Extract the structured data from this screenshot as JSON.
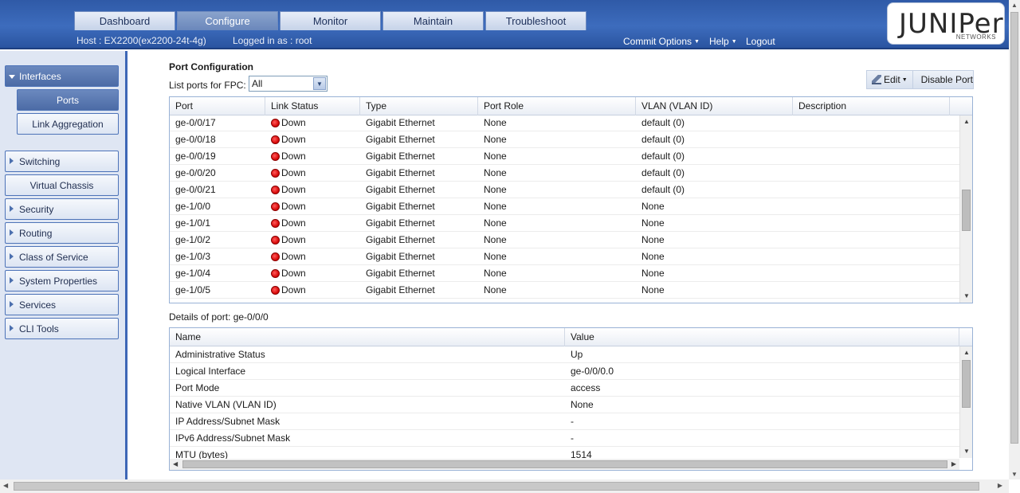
{
  "header": {
    "tabs": [
      {
        "label": "Dashboard",
        "active": false
      },
      {
        "label": "Configure",
        "active": true
      },
      {
        "label": "Monitor",
        "active": false
      },
      {
        "label": "Maintain",
        "active": false
      },
      {
        "label": "Troubleshoot",
        "active": false
      }
    ],
    "host": "Host : EX2200(ex2200-24t-4g)",
    "logged_in": "Logged in as : root",
    "commit_options": "Commit Options",
    "help": "Help",
    "logout": "Logout",
    "logo": "JUNIPer",
    "logo_sub": "NETWORKS"
  },
  "sidebar": {
    "interfaces": "Interfaces",
    "ports": "Ports",
    "link_aggregation": "Link Aggregation",
    "switching": "Switching",
    "virtual_chassis": "Virtual Chassis",
    "security": "Security",
    "routing": "Routing",
    "class_of_service": "Class of Service",
    "system_properties": "System Properties",
    "services": "Services",
    "cli_tools": "CLI Tools"
  },
  "main": {
    "title": "Port Configuration",
    "fpc_label": "List ports for FPC:",
    "fpc_value": "All",
    "edit": "Edit",
    "disable_port": "Disable Port",
    "ports_columns": [
      "Port",
      "Link Status",
      "Type",
      "Port Role",
      "VLAN (VLAN ID)",
      "Description"
    ],
    "ports_rows": [
      [
        "ge-0/0/17",
        "Down",
        "Gigabit Ethernet",
        "None",
        "default (0)",
        ""
      ],
      [
        "ge-0/0/18",
        "Down",
        "Gigabit Ethernet",
        "None",
        "default (0)",
        ""
      ],
      [
        "ge-0/0/19",
        "Down",
        "Gigabit Ethernet",
        "None",
        "default (0)",
        ""
      ],
      [
        "ge-0/0/20",
        "Down",
        "Gigabit Ethernet",
        "None",
        "default (0)",
        ""
      ],
      [
        "ge-0/0/21",
        "Down",
        "Gigabit Ethernet",
        "None",
        "default (0)",
        ""
      ],
      [
        "ge-1/0/0",
        "Down",
        "Gigabit Ethernet",
        "None",
        "None",
        ""
      ],
      [
        "ge-1/0/1",
        "Down",
        "Gigabit Ethernet",
        "None",
        "None",
        ""
      ],
      [
        "ge-1/0/2",
        "Down",
        "Gigabit Ethernet",
        "None",
        "None",
        ""
      ],
      [
        "ge-1/0/3",
        "Down",
        "Gigabit Ethernet",
        "None",
        "None",
        ""
      ],
      [
        "ge-1/0/4",
        "Down",
        "Gigabit Ethernet",
        "None",
        "None",
        ""
      ],
      [
        "ge-1/0/5",
        "Down",
        "Gigabit Ethernet",
        "None",
        "None",
        ""
      ]
    ],
    "details_label": "Details of port: ge-0/0/0",
    "details_columns": [
      "Name",
      "Value"
    ],
    "details_rows": [
      [
        "Administrative Status",
        "Up"
      ],
      [
        "Logical Interface",
        "ge-0/0/0.0"
      ],
      [
        "Port Mode",
        "access"
      ],
      [
        "Native VLAN (VLAN ID)",
        "None"
      ],
      [
        "IP Address/Subnet Mask",
        "-"
      ],
      [
        "IPv6 Address/Subnet Mask",
        "-"
      ],
      [
        "MTU (bytes)",
        "1514"
      ]
    ]
  },
  "colors": {
    "header_blue": "#3d6cbd",
    "link_down_red": "#d40000",
    "sidebar_border": "#3d67b6"
  },
  "icons": {
    "status": "red-dot-icon",
    "edit": "pencil-icon",
    "sidebar_collapsed": "triangle-right-icon",
    "sidebar_expanded": "triangle-down-icon"
  }
}
